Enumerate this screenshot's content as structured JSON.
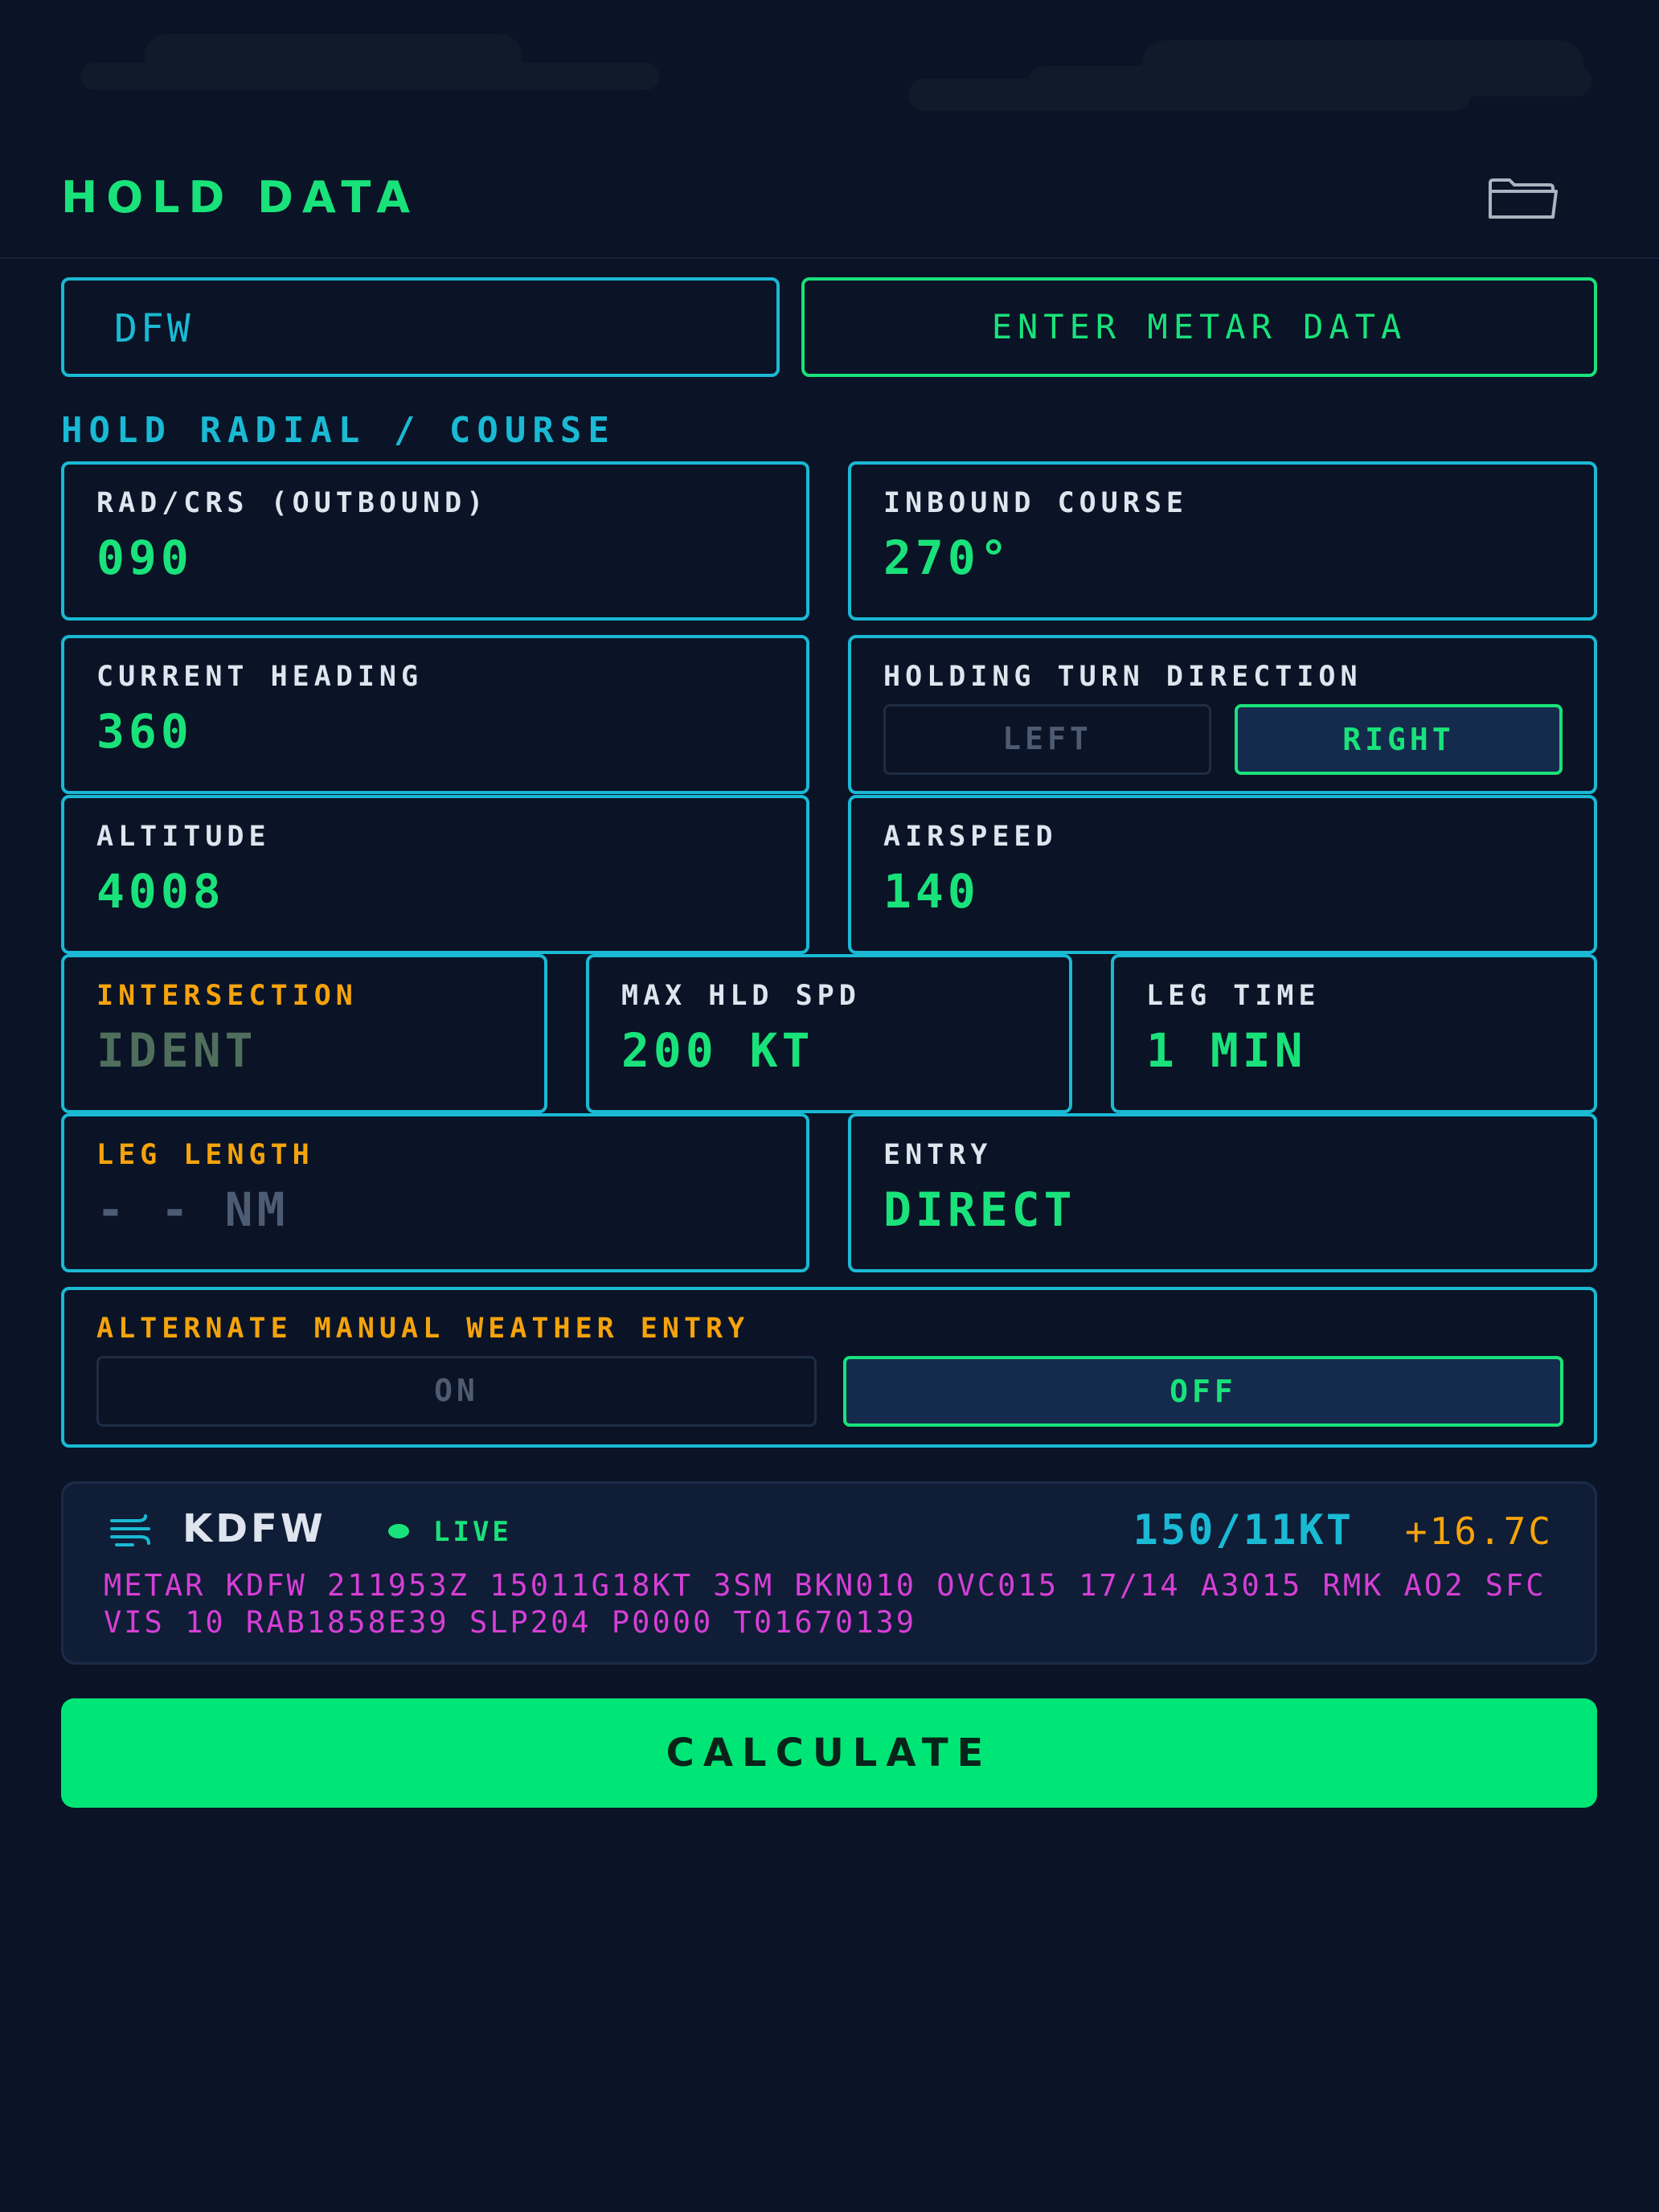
{
  "header": {
    "title": "HOLD DATA",
    "folder_icon": "folder-open-icon"
  },
  "airport": {
    "code": "DFW",
    "metar_button": "ENTER METAR DATA"
  },
  "section_title": "HOLD RADIAL / COURSE",
  "fields": {
    "radial": {
      "label": "RAD/CRS (OUTBOUND)",
      "value": "090"
    },
    "inbound": {
      "label": "INBOUND COURSE",
      "value": "270°"
    },
    "heading": {
      "label": "CURRENT HEADING",
      "value": "360"
    },
    "turn": {
      "label": "HOLDING TURN DIRECTION",
      "left": "LEFT",
      "right": "RIGHT",
      "selected": "RIGHT"
    },
    "altitude": {
      "label": "ALTITUDE",
      "value": "4008"
    },
    "airspeed": {
      "label": "AIRSPEED",
      "value": "140"
    },
    "intersection": {
      "label": "INTERSECTION",
      "value": "IDENT"
    },
    "max_speed": {
      "label": "MAX HLD SPD",
      "value": "200 KT"
    },
    "leg_time": {
      "label": "LEG TIME",
      "value": "1 MIN"
    },
    "leg_length": {
      "label": "LEG LENGTH",
      "value": "- - NM"
    },
    "entry": {
      "label": "ENTRY",
      "value": "DIRECT"
    }
  },
  "manual_weather": {
    "label": "ALTERNATE MANUAL WEATHER ENTRY",
    "on": "ON",
    "off": "OFF",
    "selected": "OFF"
  },
  "weather": {
    "station": "KDFW",
    "status": "LIVE",
    "wind": "150/11KT",
    "temp": "+16.7C",
    "raw": "METAR KDFW 211953Z 15011G18KT 3SM BKN010 OVC015 17/14 A3015 RMK AO2 SFC VIS 10 RAB1858E39 SLP204 P0000 T01670139"
  },
  "calculate_label": "CALCULATE",
  "colors": {
    "accent_green": "#19e27a",
    "accent_cyan": "#1ab9d4",
    "warning_orange": "#f5a30c",
    "metar_magenta": "#d63fd6",
    "background": "#0a1426"
  }
}
